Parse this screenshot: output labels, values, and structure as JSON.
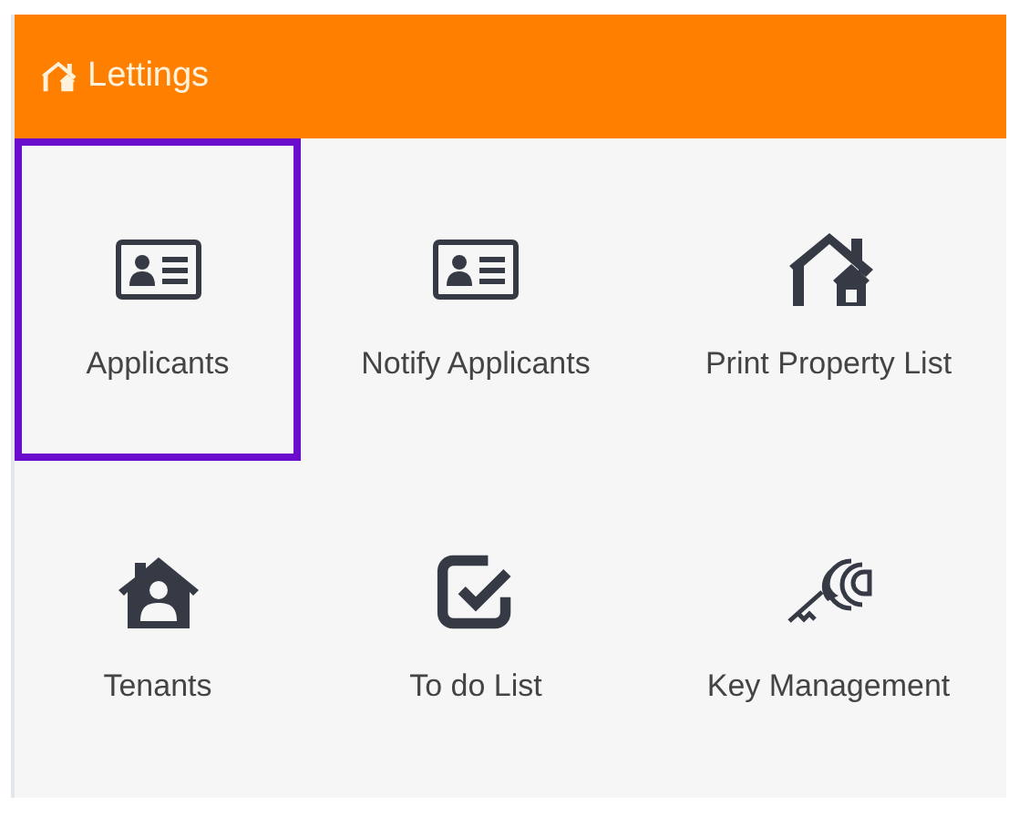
{
  "panel": {
    "title": "Lettings"
  },
  "tiles": [
    {
      "label": "Applicants",
      "selected": true
    },
    {
      "label": "Notify Applicants",
      "selected": false
    },
    {
      "label": "Print Property List",
      "selected": false
    },
    {
      "label": "Tenants",
      "selected": false
    },
    {
      "label": "To do List",
      "selected": false
    },
    {
      "label": "Key Management",
      "selected": false
    }
  ]
}
